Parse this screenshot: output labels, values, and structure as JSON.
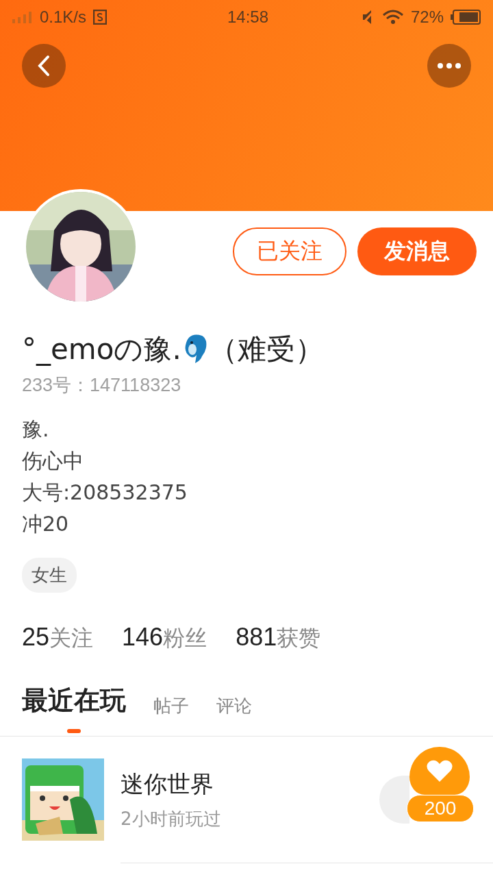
{
  "status_bar": {
    "speed": "0.1K/s",
    "time": "14:58",
    "battery": "72%"
  },
  "profile": {
    "name": "°_emoの豫.",
    "name_suffix": "（难受）",
    "id_line": "233号：147118323",
    "bio": [
      "豫.",
      "伤心中",
      "大号:208532375",
      "冲20"
    ],
    "tag": "女生",
    "stats": [
      {
        "count": "25",
        "label": "关注"
      },
      {
        "count": "146",
        "label": "粉丝"
      },
      {
        "count": "881",
        "label": "获赞"
      }
    ]
  },
  "actions": [
    {
      "label": "已关注",
      "kind": "outline"
    },
    {
      "label": "发消息",
      "kind": "filled"
    }
  ],
  "tabs": [
    {
      "label": "最近在玩",
      "selected": true
    },
    {
      "label": "帖子",
      "selected": false
    },
    {
      "label": "评论",
      "selected": false
    }
  ],
  "games": [
    {
      "title": "迷你世界",
      "subtitle": "2小时前玩过"
    }
  ],
  "like_badge": {
    "count": "200"
  }
}
